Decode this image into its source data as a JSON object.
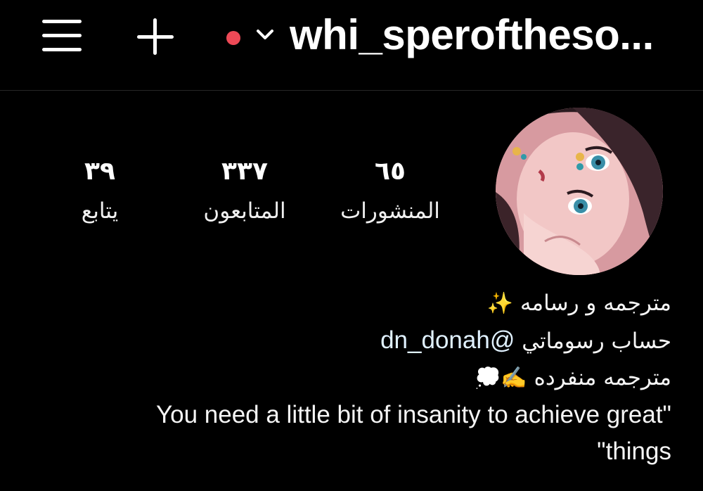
{
  "header": {
    "username": "whi_speroftheso...",
    "status_dot_color": "#ed4956",
    "icons": [
      "menu-icon",
      "plus-icon",
      "chevron-down-icon"
    ]
  },
  "profile": {
    "avatar_icon": "profile-avatar-anime-illustration",
    "stats": {
      "posts": {
        "value": "٦٥",
        "label": "المنشورات"
      },
      "followers": {
        "value": "٣٣٧",
        "label": "المتابعون"
      },
      "following": {
        "value": "٣٩",
        "label": "يتابع"
      }
    }
  },
  "bio": {
    "line1_text": "مترجمه و رسامه",
    "line1_emoji": "✨",
    "line2_text": "حساب رسوماتي",
    "line2_mention": "@dn_donah",
    "line3_text": "مترجمه منفرده",
    "line3_emoji": "✍️💭",
    "line4": "You need a little bit of insanity to achieve great\"",
    "line5": "\"things"
  },
  "colors": {
    "background": "#000000",
    "text": "#f5f5f5",
    "mention": "#e0f1ff",
    "divider": "#262626"
  }
}
